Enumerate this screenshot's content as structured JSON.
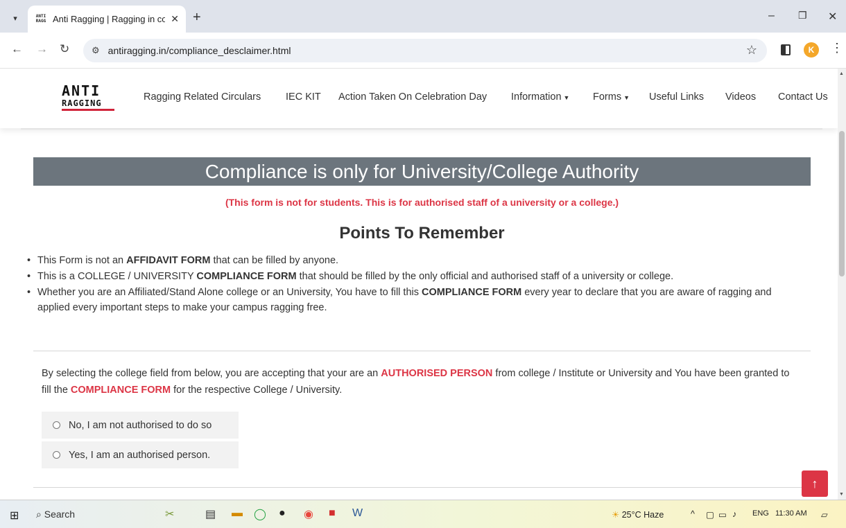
{
  "browser": {
    "tab_title": "Anti Ragging | Ragging in colle",
    "tab_favicon_text": "ANTI RAGG",
    "url": "antiragging.in/compliance_desclaimer.html",
    "profile_initial": "K"
  },
  "nav": {
    "logo_top": "ANTI",
    "logo_bottom": "RAGGING",
    "links": [
      "Ragging Related Circulars",
      "IEC KIT",
      "Action Taken On Celebration Day",
      "Information",
      "Forms",
      "Useful Links",
      "Videos",
      "Contact Us"
    ]
  },
  "page": {
    "banner": "Compliance is only for University/College Authority",
    "note": "(This form is not for students. This is for authorised staff of a university or a college.)",
    "heading": "Points To Remember",
    "points": [
      {
        "pre": "This Form is not an ",
        "bold": "AFFIDAVIT FORM",
        "post": " that can be filled by anyone."
      },
      {
        "pre": "This is a COLLEGE / UNIVERSITY ",
        "bold": "COMPLIANCE FORM",
        "post": " that should be filled by the only official and authorised staff of a university or college."
      },
      {
        "pre": "Whether you are an Affiliated/Stand Alone college or an University, You have to fill this ",
        "bold": "COMPLIANCE FORM",
        "post": " every year to declare that you are aware of ragging and applied every important steps to make your campus ragging free."
      }
    ],
    "consent": {
      "part1": "By selecting the college field from below, you are accepting that your are an ",
      "hl1": "AUTHORISED PERSON",
      "part2": " from college / Institute or University and You have been granted to fill the ",
      "hl2": "COMPLIANCE FORM",
      "part3": " for the respective College / University."
    },
    "options": [
      "No, I am not authorised to do so",
      "Yes, I am an authorised person."
    ]
  },
  "taskbar": {
    "search": "Search",
    "weather": "25°C  Haze",
    "lang": "ENG",
    "time": "11:30 AM"
  },
  "colors": {
    "accent_red": "#dc3545",
    "banner_gray": "#6c757d"
  }
}
